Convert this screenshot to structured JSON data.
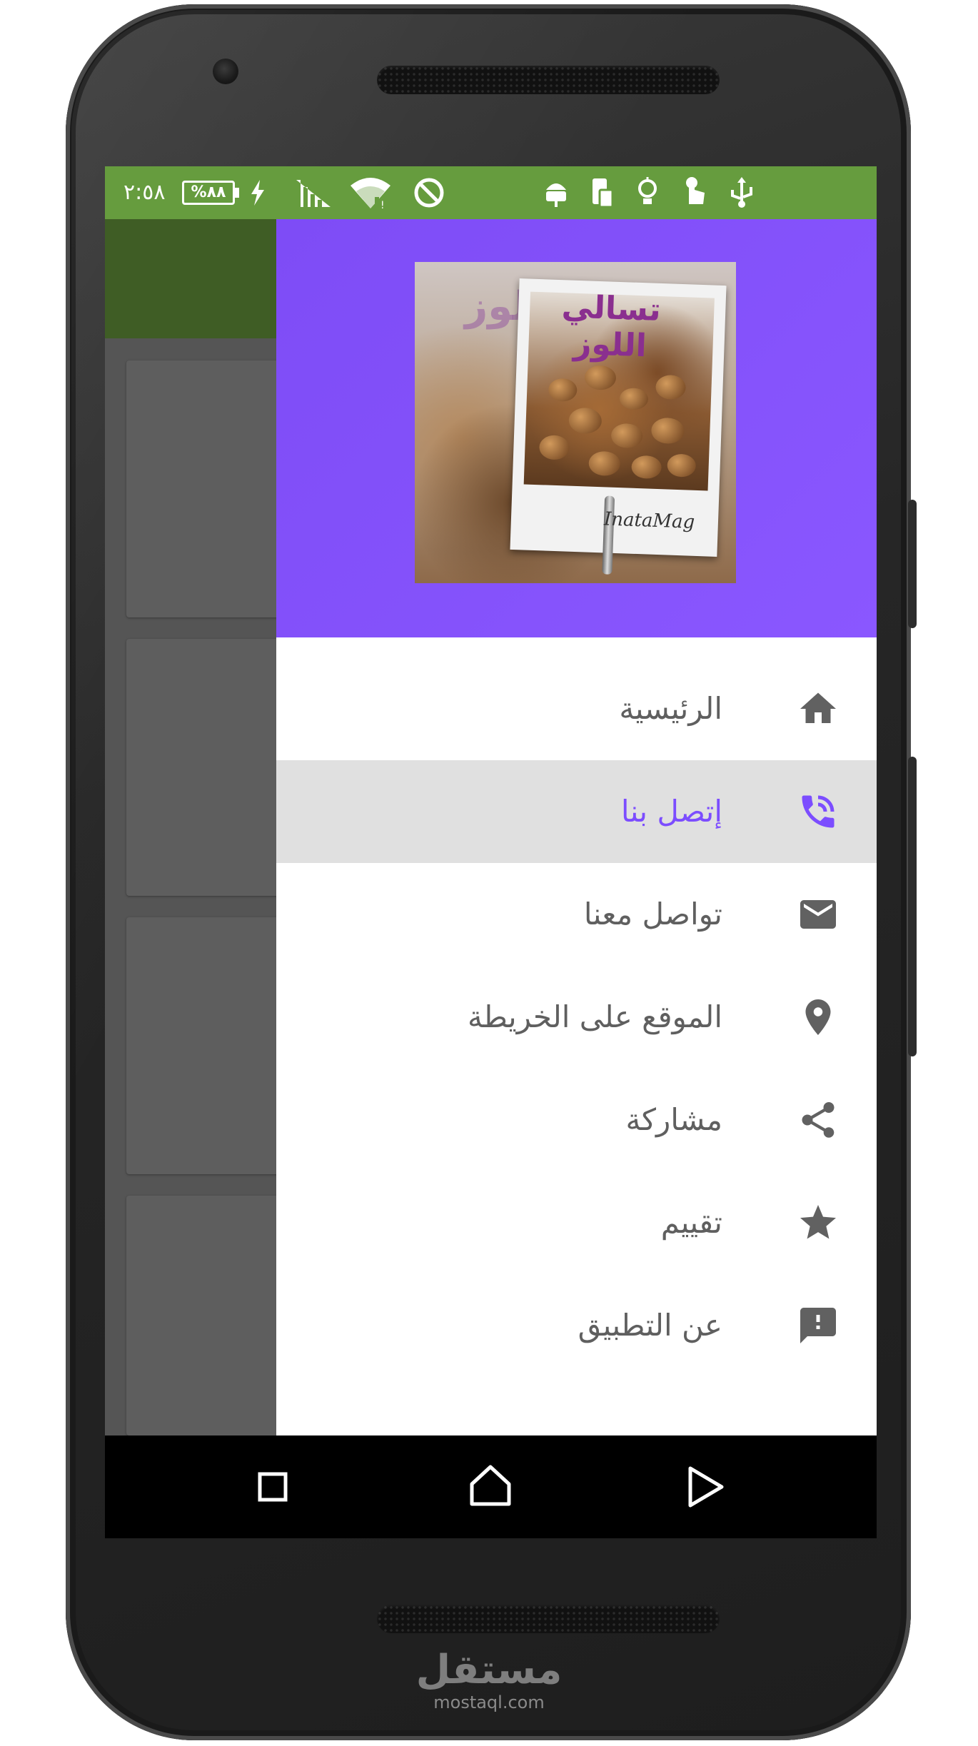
{
  "status_bar": {
    "time": "٢:٥٨",
    "battery_text": "%٨٨",
    "icons": [
      "android-debug-icon",
      "phone-screen-icon",
      "bulb-icon",
      "touch-icon",
      "usb-icon",
      "do-not-disturb-icon",
      "wifi-icon",
      "signal-icon",
      "charging-icon"
    ],
    "background_color": "#669c3e"
  },
  "drawer": {
    "header_color": "#8a57ff",
    "header_image": {
      "title": "تسالي اللوز",
      "caption": "InataMag"
    },
    "items": [
      {
        "label": "الرئيسية",
        "icon": "home-icon",
        "selected": false
      },
      {
        "label": "إتصل بنا",
        "icon": "phone-call-icon",
        "selected": true
      },
      {
        "label": "تواصل معنا",
        "icon": "mail-icon",
        "selected": false
      },
      {
        "label": "الموقع على الخريطة",
        "icon": "location-pin-icon",
        "selected": false
      },
      {
        "label": "مشاركة",
        "icon": "share-icon",
        "selected": false
      },
      {
        "label": "تقييم",
        "icon": "star-icon",
        "selected": false
      },
      {
        "label": "عن التطبيق",
        "icon": "feedback-icon",
        "selected": false
      }
    ],
    "accent_color": "#7c4dff"
  },
  "nav_bar": {
    "buttons": [
      "recent-apps-icon",
      "home-nav-icon",
      "back-icon"
    ]
  },
  "watermark": {
    "arabic": "مستقل",
    "domain": "mostaql.com"
  }
}
